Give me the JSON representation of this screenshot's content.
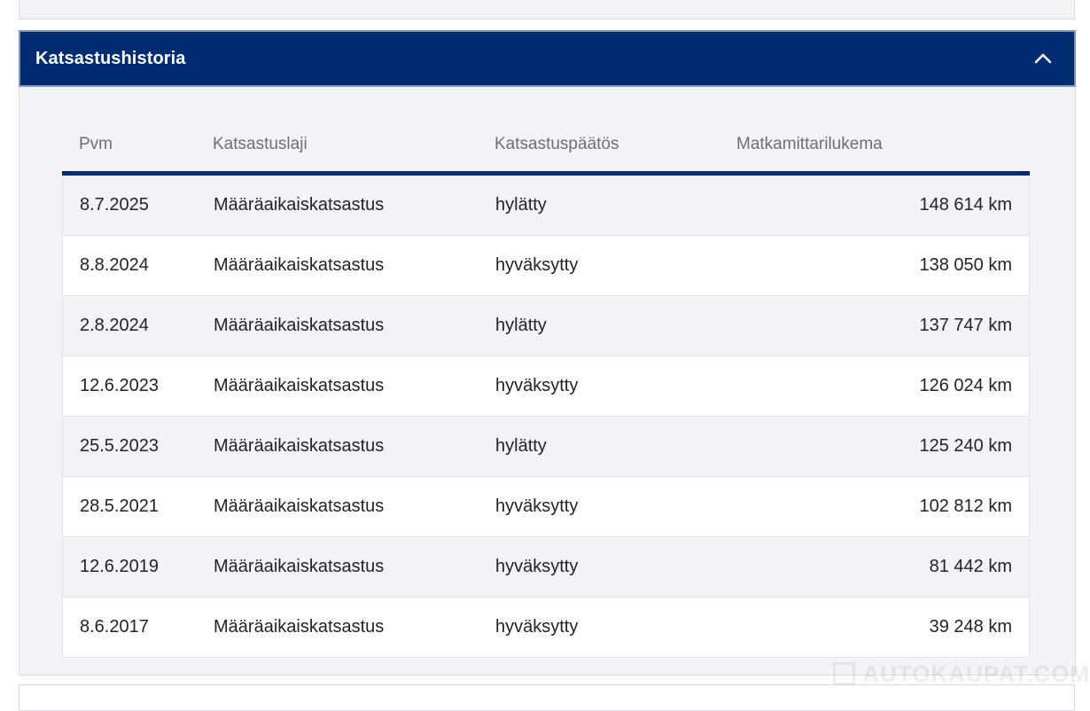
{
  "section": {
    "title": "Katsastushistoria",
    "toggle_icon": "chevron-up-icon"
  },
  "table": {
    "headers": [
      "Pvm",
      "Katsastuslaji",
      "Katsastuspäätös",
      "Matkamittarilukema"
    ],
    "rows": [
      {
        "date": "8.7.2025",
        "type": "Määräaikaiskatsastus",
        "result": "hylätty",
        "odometer": "148 614 km"
      },
      {
        "date": "8.8.2024",
        "type": "Määräaikaiskatsastus",
        "result": "hyväksytty",
        "odometer": "138 050 km"
      },
      {
        "date": "2.8.2024",
        "type": "Määräaikaiskatsastus",
        "result": "hylätty",
        "odometer": "137 747 km"
      },
      {
        "date": "12.6.2023",
        "type": "Määräaikaiskatsastus",
        "result": "hyväksytty",
        "odometer": "126 024 km"
      },
      {
        "date": "25.5.2023",
        "type": "Määräaikaiskatsastus",
        "result": "hylätty",
        "odometer": "125 240 km"
      },
      {
        "date": "28.5.2021",
        "type": "Määräaikaiskatsastus",
        "result": "hyväksytty",
        "odometer": "102 812 km"
      },
      {
        "date": "12.6.2019",
        "type": "Määräaikaiskatsastus",
        "result": "hyväksytty",
        "odometer": "81 442 km"
      },
      {
        "date": "8.6.2017",
        "type": "Määräaikaiskatsastus",
        "result": "hyväksytty",
        "odometer": "39 248 km"
      }
    ]
  },
  "watermark": {
    "text": "AUTOKAUPAT.COM"
  },
  "colors": {
    "header_bg": "#002c72",
    "header_text": "#ffffff",
    "row_alt": "#f2f3f6",
    "row": "#ffffff"
  }
}
